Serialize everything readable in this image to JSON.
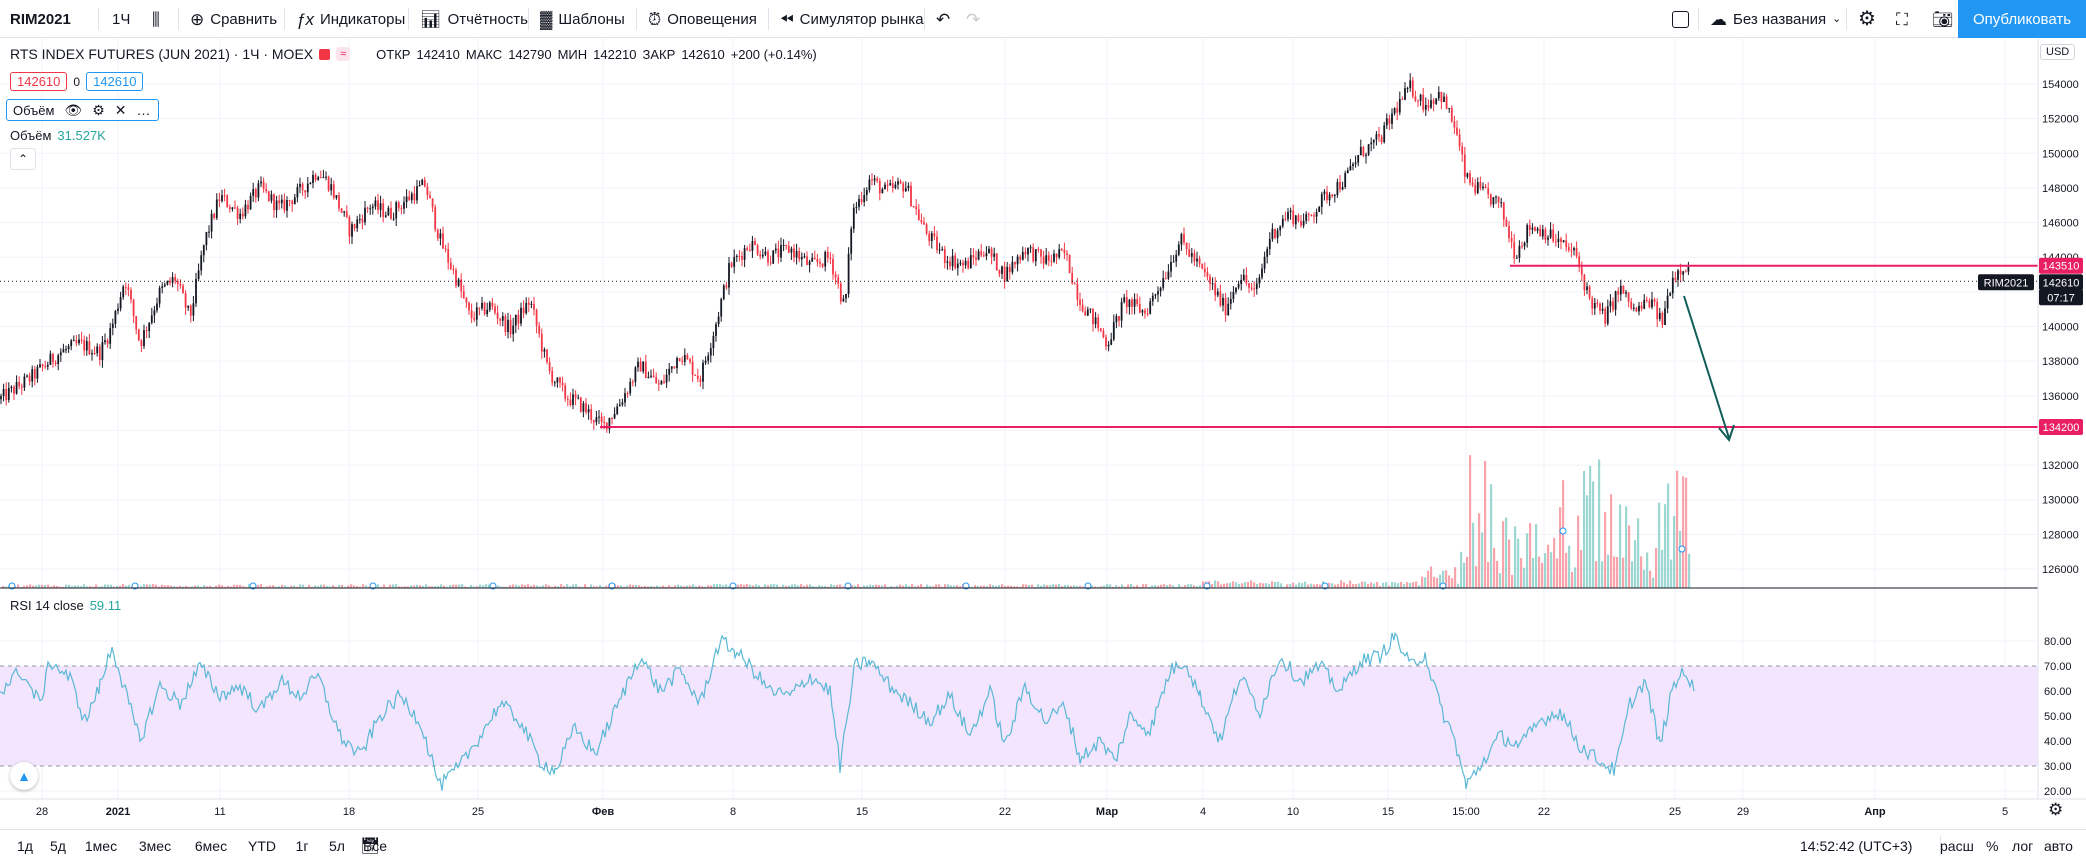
{
  "toolbar": {
    "symbol": "RIM2021",
    "interval": "1Ч",
    "compare": "Сравнить",
    "indicators": "Индикаторы",
    "reports": "Отчётность",
    "templates": "Шаблоны",
    "alerts": "Оповещения",
    "replay": "Симулятор рынка",
    "layout_name": "Без названия",
    "publish": "Опубликовать"
  },
  "legend": {
    "title": "RTS INDEX FUTURES (JUN 2021) · 1Ч · MOEX",
    "open_label": "ОТКР",
    "open": "142410",
    "high_label": "МАКС",
    "high": "142790",
    "low_label": "МИН",
    "low": "142210",
    "close_label": "ЗАКР",
    "close": "142610",
    "change": "+200 (+0.14%)",
    "sell_price": "142610",
    "spread": "0",
    "buy_price": "142610"
  },
  "volume": {
    "label": "Объём",
    "value_label": "Объём",
    "value": "31.527K"
  },
  "rsi": {
    "label": "RSI 14 close",
    "value": "59.11",
    "levels": [
      "80.00",
      "70.00",
      "60.00",
      "50.00",
      "40.00",
      "30.00",
      "20.00"
    ]
  },
  "price_axis": {
    "currency": "USD",
    "ticks": [
      "154000",
      "152000",
      "150000",
      "148000",
      "146000",
      "144000",
      "142000",
      "140000",
      "138000",
      "136000",
      "134000",
      "132000",
      "130000",
      "128000",
      "126000"
    ],
    "badge_resistance": "143510",
    "badge_current": "142610",
    "badge_countdown": "07:17",
    "badge_symbol": "RIM2021",
    "badge_support": "134200"
  },
  "time_axis": {
    "ticks": [
      "28",
      "2021",
      "11",
      "18",
      "25",
      "Фев",
      "8",
      "15",
      "22",
      "Мар",
      "4",
      "10",
      "15",
      "15:00",
      "22",
      "25",
      "29",
      "Апр",
      "5"
    ]
  },
  "bottom": {
    "ranges": [
      "1д",
      "5д",
      "1мес",
      "3мес",
      "6мес",
      "YTD",
      "1г",
      "5л",
      "Все"
    ],
    "clock": "14:52:42 (UTC+3)",
    "scale_fit": "расш",
    "scale_pct": "%",
    "scale_log": "лог",
    "scale_auto": "авто"
  },
  "colors": {
    "up": "#131722",
    "down": "#f23645",
    "accent": "#2196f3",
    "level_line": "#e91e63",
    "rsi_line": "#5ab8d6",
    "rsi_band": "#f3e5fd",
    "arrow": "#115e58"
  },
  "chart_data": {
    "type": "candlestick",
    "y_range": [
      125000,
      155500
    ],
    "series_close": [
      {
        "t": "28",
        "v": 136500
      },
      {
        "t": "2021",
        "v": 142500
      },
      {
        "t": "11",
        "v": 148500
      },
      {
        "t": "18",
        "v": 146000
      },
      {
        "t": "25",
        "v": 141000
      },
      {
        "t": "Фев",
        "v": 134200
      },
      {
        "t": "8",
        "v": 144500
      },
      {
        "t": "15",
        "v": 148000
      },
      {
        "t": "22",
        "v": 143500
      },
      {
        "t": "Мар",
        "v": 139000
      },
      {
        "t": "4",
        "v": 144000
      },
      {
        "t": "10",
        "v": 147000
      },
      {
        "t": "15",
        "v": 153500
      },
      {
        "t": "15:00",
        "v": 147500
      },
      {
        "t": "22",
        "v": 143000
      },
      {
        "t": "25",
        "v": 140500
      },
      {
        "t": "now",
        "v": 142610
      }
    ],
    "levels": [
      134200,
      143510
    ],
    "rsi_range": [
      20,
      85
    ],
    "rsi_last": 59.11,
    "rsi_band": [
      30,
      70
    ]
  }
}
